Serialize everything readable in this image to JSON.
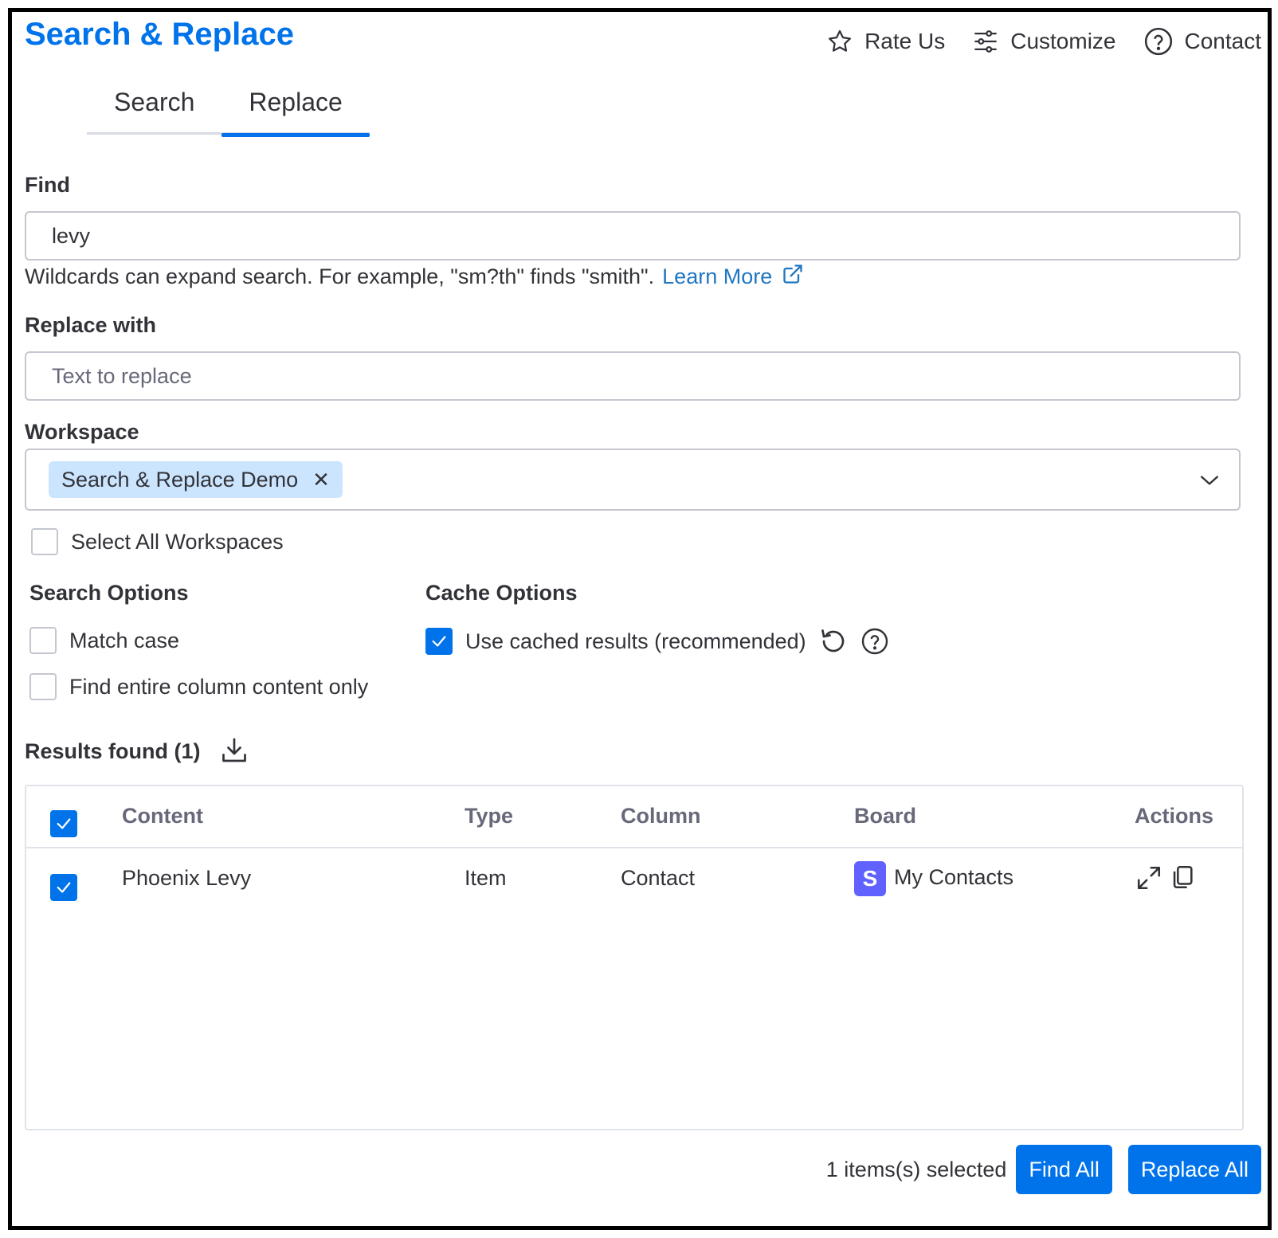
{
  "app": {
    "title": "Search & Replace"
  },
  "topnav": {
    "rate_label": "Rate Us",
    "customize_label": "Customize",
    "contact_label": "Contact"
  },
  "tabs": [
    {
      "label": "Search",
      "active": false
    },
    {
      "label": "Replace",
      "active": true
    }
  ],
  "find": {
    "label": "Find",
    "value": "levy",
    "hint": "Wildcards can expand search. For example, \"sm?th\" finds \"smith\".",
    "learn_more": "Learn More"
  },
  "replace": {
    "label": "Replace with",
    "value": "",
    "placeholder": "Text to replace"
  },
  "workspace": {
    "label": "Workspace",
    "selected_chip": "Search & Replace Demo",
    "select_all_label": "Select All Workspaces",
    "select_all_checked": false
  },
  "search_options": {
    "title": "Search Options",
    "match_case": "Match case",
    "entire_column": "Find entire column content only"
  },
  "cache_options": {
    "title": "Cache Options",
    "use_cached": "Use cached results (recommended)",
    "use_cached_checked": true
  },
  "results": {
    "title": "Results found (1)",
    "columns": [
      "Content",
      "Type",
      "Column",
      "Board",
      "Actions"
    ],
    "rows": [
      {
        "content": "Phoenix Levy",
        "type": "Item",
        "column": "Contact",
        "board": "My Contacts",
        "board_badge": "S",
        "checked": true
      }
    ]
  },
  "footer": {
    "selected_text": "1 items(s) selected",
    "find_all": "Find All",
    "replace_all": "Replace All"
  },
  "colors": {
    "accent": "#0073ea",
    "chip_bg": "#cce5ff",
    "board_badge": "#6161ff",
    "link": "#1f76c2"
  }
}
